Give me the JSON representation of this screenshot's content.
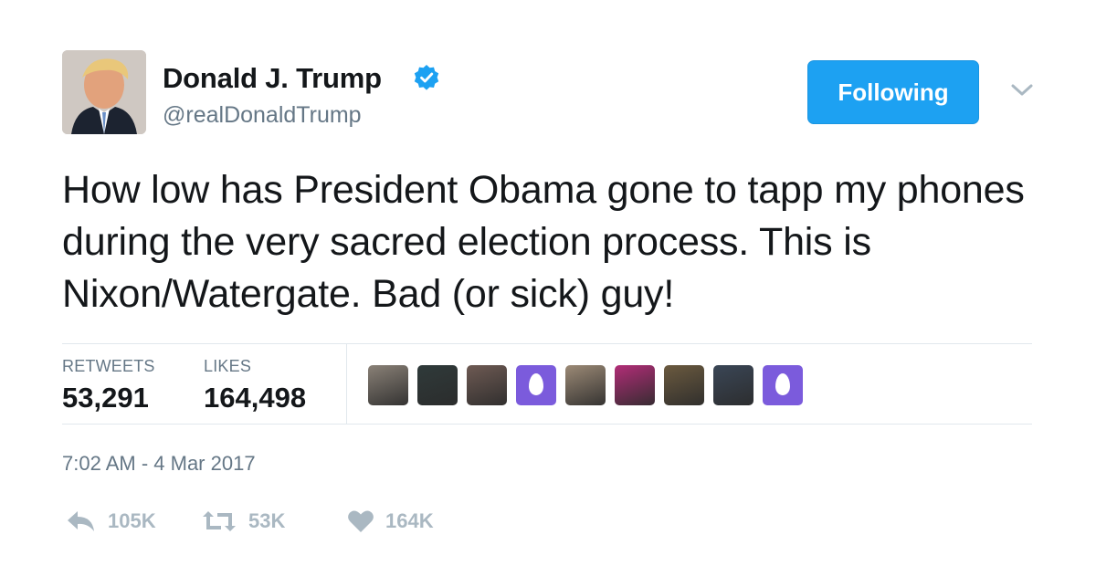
{
  "author": {
    "name": "Donald J. Trump",
    "handle": "@realDonaldTrump",
    "verified": true,
    "avatar_icon": "profile-photo"
  },
  "follow_button": {
    "label": "Following"
  },
  "menu": {
    "icon": "chevron-down-icon"
  },
  "tweet": {
    "text": "How low has President Obama gone to tapp my phones during the very sacred election process. This is Nixon/Watergate. Bad (or sick) guy!"
  },
  "stats": {
    "retweets_label": "RETWEETS",
    "retweets_value": "53,291",
    "likes_label": "LIKES",
    "likes_value": "164,498"
  },
  "likers": [
    {
      "kind": "photo",
      "color": "#8a8177"
    },
    {
      "kind": "photo",
      "color": "#2f3a3a"
    },
    {
      "kind": "photo",
      "color": "#6e5a53"
    },
    {
      "kind": "egg",
      "color": "#7b5bdc"
    },
    {
      "kind": "photo",
      "color": "#9c8a76"
    },
    {
      "kind": "photo",
      "color": "#b22d77"
    },
    {
      "kind": "photo",
      "color": "#6b5a3f"
    },
    {
      "kind": "photo",
      "color": "#3a4656"
    },
    {
      "kind": "egg",
      "color": "#7b5bdc"
    }
  ],
  "timestamp": "7:02 AM - 4 Mar 2017",
  "actions": {
    "reply_count": "105K",
    "retweet_count": "53K",
    "like_count": "164K"
  },
  "colors": {
    "accent": "#1da1f2",
    "text": "#14171a",
    "muted": "#657786",
    "icon_gray": "#aab8c2",
    "verified_blue": "#1da1f2"
  }
}
